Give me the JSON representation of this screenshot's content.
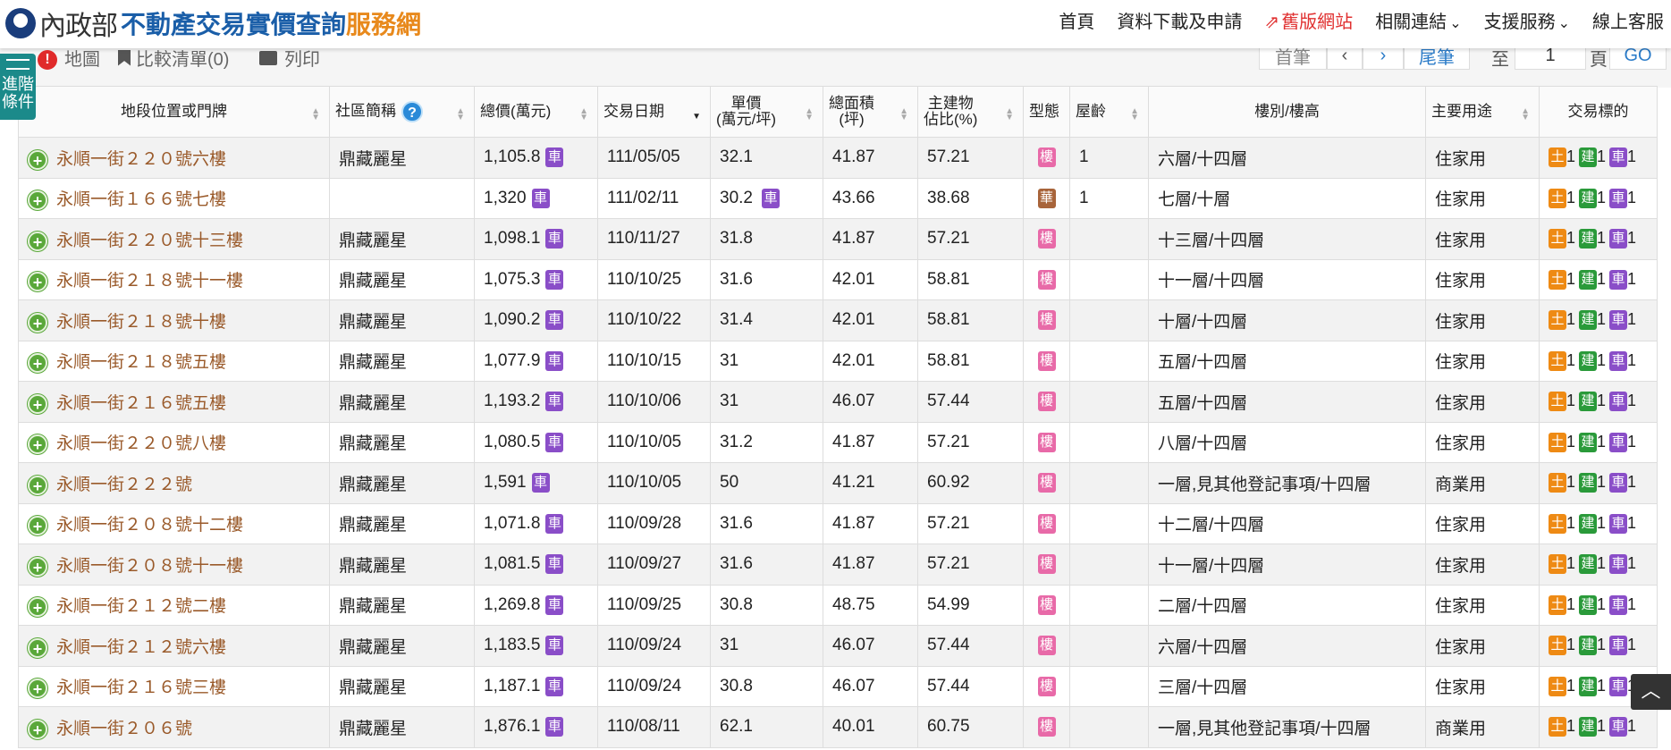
{
  "header": {
    "ministry": "內政部",
    "title": "不動產交易實價查詢",
    "title_suffix": "服務網",
    "nav": [
      {
        "label": "首頁",
        "color": "normal"
      },
      {
        "label": "資料下載及申請",
        "color": "normal"
      },
      {
        "label": "舊版網站",
        "color": "red",
        "icon": "external-link-icon"
      },
      {
        "label": "相關連結",
        "color": "normal",
        "icon": "chevron-down-icon"
      },
      {
        "label": "支援服務",
        "color": "normal",
        "icon": "chevron-down-icon"
      },
      {
        "label": "線上客服",
        "color": "normal"
      }
    ]
  },
  "toolbar": {
    "map": "地圖",
    "compare": "比較清單(0)",
    "print": "列印",
    "first": "首筆",
    "prev": "‹",
    "next": "›",
    "last": "尾筆",
    "to": "至",
    "page_value": "1",
    "page_unit": "頁",
    "go": "GO"
  },
  "advanced": {
    "label": "進階條件",
    "alert": "!"
  },
  "columns": [
    "地段位置或門牌",
    "社區簡稱",
    "總價(萬元)",
    "交易日期",
    "單價\n(萬元/坪)",
    "總面積\n(坪)",
    "主建物\n佔比(%)",
    "型態",
    "屋齡",
    "樓別/樓高",
    "主要用途",
    "交易標的"
  ],
  "badges": {
    "car": "車",
    "lou": "樓",
    "hua": "華",
    "tu": "土",
    "jian": "建"
  },
  "colors": {
    "header_blue": "#1a5ea8",
    "header_orange": "#e8891c",
    "address": "#9a5a2a",
    "car_badge": "#8a4ec8",
    "lou_badge": "#e86aa8",
    "hua_badge": "#a8643a",
    "tu_badge": "#ee8a14",
    "jian_badge": "#2a9a3a",
    "plus": "#5aa83a"
  },
  "rows": [
    {
      "addr": "永順一街２２０號六樓",
      "community": "鼎藏麗星",
      "total": "1,105.8",
      "total_car": true,
      "date": "111/05/05",
      "unit": "32.1",
      "unit_car": false,
      "area": "41.87",
      "ratio": "57.21",
      "type": "lou",
      "age": "1",
      "floor": "六層/十四層",
      "use": "住家用",
      "t": "1",
      "j": "1",
      "c": "1"
    },
    {
      "addr": "永順一街１６６號七樓",
      "community": "",
      "total": "1,320",
      "total_car": true,
      "date": "111/02/11",
      "unit": "30.2",
      "unit_car": true,
      "area": "43.66",
      "ratio": "38.68",
      "type": "hua",
      "age": "1",
      "floor": "七層/十層",
      "use": "住家用",
      "t": "1",
      "j": "1",
      "c": "1"
    },
    {
      "addr": "永順一街２２０號十三樓",
      "community": "鼎藏麗星",
      "total": "1,098.1",
      "total_car": true,
      "date": "110/11/27",
      "unit": "31.8",
      "unit_car": false,
      "area": "41.87",
      "ratio": "57.21",
      "type": "lou",
      "age": "",
      "floor": "十三層/十四層",
      "use": "住家用",
      "t": "1",
      "j": "1",
      "c": "1"
    },
    {
      "addr": "永順一街２１８號十一樓",
      "community": "鼎藏麗星",
      "total": "1,075.3",
      "total_car": true,
      "date": "110/10/25",
      "unit": "31.6",
      "unit_car": false,
      "area": "42.01",
      "ratio": "58.81",
      "type": "lou",
      "age": "",
      "floor": "十一層/十四層",
      "use": "住家用",
      "t": "1",
      "j": "1",
      "c": "1"
    },
    {
      "addr": "永順一街２１８號十樓",
      "community": "鼎藏麗星",
      "total": "1,090.2",
      "total_car": true,
      "date": "110/10/22",
      "unit": "31.4",
      "unit_car": false,
      "area": "42.01",
      "ratio": "58.81",
      "type": "lou",
      "age": "",
      "floor": "十層/十四層",
      "use": "住家用",
      "t": "1",
      "j": "1",
      "c": "1"
    },
    {
      "addr": "永順一街２１８號五樓",
      "community": "鼎藏麗星",
      "total": "1,077.9",
      "total_car": true,
      "date": "110/10/15",
      "unit": "31",
      "unit_car": false,
      "area": "42.01",
      "ratio": "58.81",
      "type": "lou",
      "age": "",
      "floor": "五層/十四層",
      "use": "住家用",
      "t": "1",
      "j": "1",
      "c": "1"
    },
    {
      "addr": "永順一街２１６號五樓",
      "community": "鼎藏麗星",
      "total": "1,193.2",
      "total_car": true,
      "date": "110/10/06",
      "unit": "31",
      "unit_car": false,
      "area": "46.07",
      "ratio": "57.44",
      "type": "lou",
      "age": "",
      "floor": "五層/十四層",
      "use": "住家用",
      "t": "1",
      "j": "1",
      "c": "1"
    },
    {
      "addr": "永順一街２２０號八樓",
      "community": "鼎藏麗星",
      "total": "1,080.5",
      "total_car": true,
      "date": "110/10/05",
      "unit": "31.2",
      "unit_car": false,
      "area": "41.87",
      "ratio": "57.21",
      "type": "lou",
      "age": "",
      "floor": "八層/十四層",
      "use": "住家用",
      "t": "1",
      "j": "1",
      "c": "1"
    },
    {
      "addr": "永順一街２２２號",
      "community": "鼎藏麗星",
      "total": "1,591",
      "total_car": true,
      "date": "110/10/05",
      "unit": "50",
      "unit_car": false,
      "area": "41.21",
      "ratio": "60.92",
      "type": "lou",
      "age": "",
      "floor": "一層,見其他登記事項/十四層",
      "use": "商業用",
      "t": "1",
      "j": "1",
      "c": "1"
    },
    {
      "addr": "永順一街２０８號十二樓",
      "community": "鼎藏麗星",
      "total": "1,071.8",
      "total_car": true,
      "date": "110/09/28",
      "unit": "31.6",
      "unit_car": false,
      "area": "41.87",
      "ratio": "57.21",
      "type": "lou",
      "age": "",
      "floor": "十二層/十四層",
      "use": "住家用",
      "t": "1",
      "j": "1",
      "c": "1"
    },
    {
      "addr": "永順一街２０８號十一樓",
      "community": "鼎藏麗星",
      "total": "1,081.5",
      "total_car": true,
      "date": "110/09/27",
      "unit": "31.6",
      "unit_car": false,
      "area": "41.87",
      "ratio": "57.21",
      "type": "lou",
      "age": "",
      "floor": "十一層/十四層",
      "use": "住家用",
      "t": "1",
      "j": "1",
      "c": "1"
    },
    {
      "addr": "永順一街２１２號二樓",
      "community": "鼎藏麗星",
      "total": "1,269.8",
      "total_car": true,
      "date": "110/09/25",
      "unit": "30.8",
      "unit_car": false,
      "area": "48.75",
      "ratio": "54.99",
      "type": "lou",
      "age": "",
      "floor": "二層/十四層",
      "use": "住家用",
      "t": "1",
      "j": "1",
      "c": "1"
    },
    {
      "addr": "永順一街２１２號六樓",
      "community": "鼎藏麗星",
      "total": "1,183.5",
      "total_car": true,
      "date": "110/09/24",
      "unit": "31",
      "unit_car": false,
      "area": "46.07",
      "ratio": "57.44",
      "type": "lou",
      "age": "",
      "floor": "六層/十四層",
      "use": "住家用",
      "t": "1",
      "j": "1",
      "c": "1"
    },
    {
      "addr": "永順一街２１６號三樓",
      "community": "鼎藏麗星",
      "total": "1,187.1",
      "total_car": true,
      "date": "110/09/24",
      "unit": "30.8",
      "unit_car": false,
      "area": "46.07",
      "ratio": "57.44",
      "type": "lou",
      "age": "",
      "floor": "三層/十四層",
      "use": "住家用",
      "t": "1",
      "j": "1",
      "c": "1"
    },
    {
      "addr": "永順一街２０６號",
      "community": "鼎藏麗星",
      "total": "1,876.1",
      "total_car": true,
      "date": "110/08/11",
      "unit": "62.1",
      "unit_car": false,
      "area": "40.01",
      "ratio": "60.75",
      "type": "lou",
      "age": "",
      "floor": "一層,見其他登記事項/十四層",
      "use": "商業用",
      "t": "1",
      "j": "1",
      "c": "1"
    }
  ]
}
